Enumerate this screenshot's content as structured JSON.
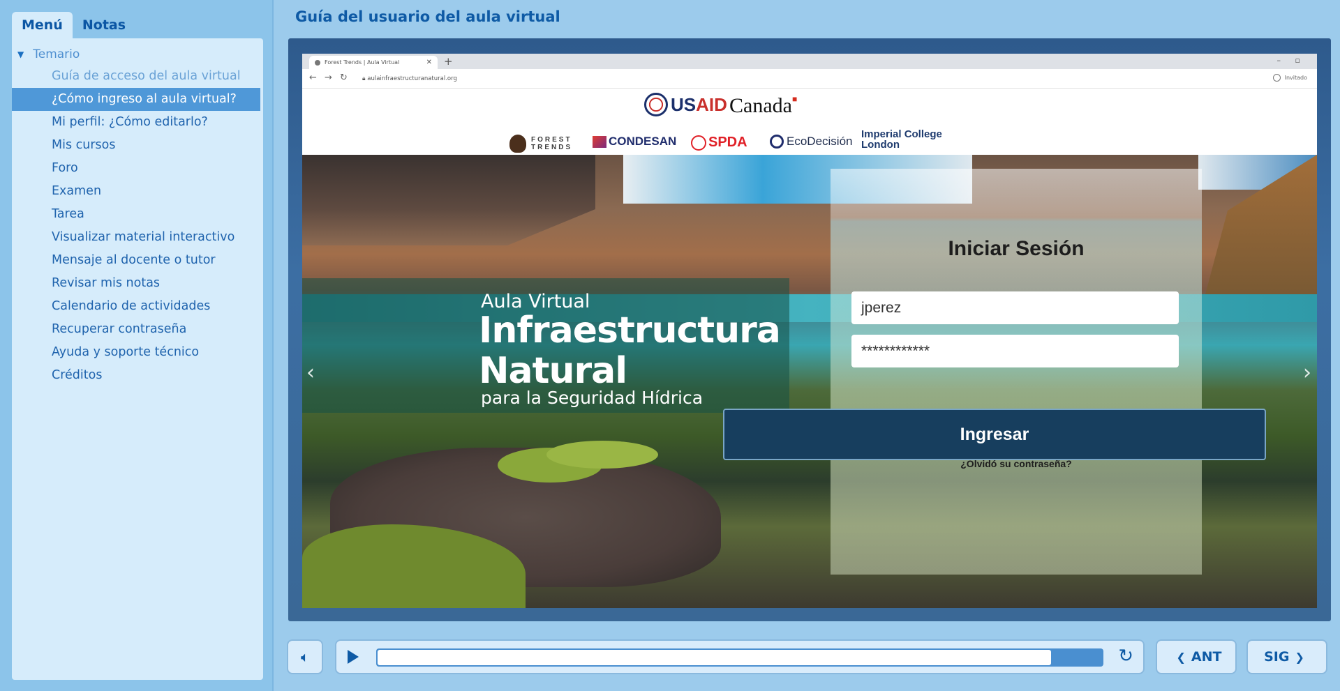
{
  "sidebar": {
    "tabs": [
      {
        "label": "Menú"
      },
      {
        "label": "Notas"
      }
    ],
    "tree_title": "Temario",
    "items": [
      {
        "label": "Guía de acceso del aula virtual"
      },
      {
        "label": "¿Cómo ingreso al aula virtual?"
      },
      {
        "label": "Mi perfil: ¿Cómo editarlo?"
      },
      {
        "label": "Mis cursos"
      },
      {
        "label": "Foro"
      },
      {
        "label": "Examen"
      },
      {
        "label": "Tarea"
      },
      {
        "label": "Visualizar material interactivo"
      },
      {
        "label": "Mensaje al docente o tutor"
      },
      {
        "label": "Revisar mis notas"
      },
      {
        "label": "Calendario de actividades"
      },
      {
        "label": "Recuperar contraseña"
      },
      {
        "label": "Ayuda y soporte técnico"
      },
      {
        "label": "Créditos"
      }
    ]
  },
  "main": {
    "title": "Guía del usuario del aula virtual"
  },
  "browser": {
    "tab_title": "Forest Trends | Aula Virtual",
    "url": "aulainfraestructuranatural.org",
    "guest_label": "Invitado"
  },
  "site": {
    "logo_usaid_us": "US",
    "logo_usaid_aid": "AID",
    "logo_canada": "Canada",
    "partners": {
      "forest_trends": "FOREST TRENDS",
      "condesan": "CONDESAN",
      "spda": "SPDA",
      "ecodecision": "EcoDecisión",
      "imperial": "Imperial College London"
    },
    "hero": {
      "line1": "Aula Virtual",
      "line2": "Infraestructura",
      "line3": "Natural",
      "line4": "para la Seguridad Hídrica"
    },
    "login": {
      "title": "Iniciar Sesión",
      "username": "jperez",
      "password": "************",
      "submit": "Ingresar",
      "forgot": "¿Olvidó su contraseña?"
    }
  },
  "player": {
    "progress": 0.93,
    "prev_label": "ANT",
    "next_label": "SIG"
  },
  "colors": {
    "accent": "#0e5aa5",
    "selected_bg": "#4f98d8",
    "panel_bg": "#d6ecfb"
  }
}
